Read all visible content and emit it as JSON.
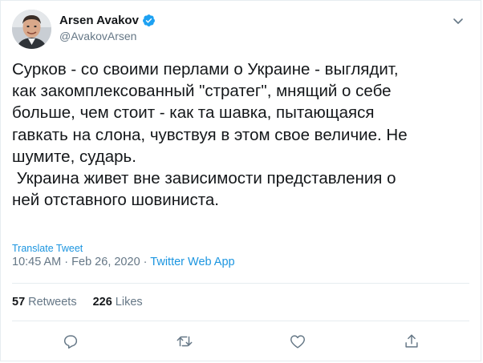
{
  "author": {
    "display_name": "Arsen Avakov",
    "handle": "@AvakovArsen",
    "verified": true
  },
  "tweet": {
    "text_lines": [
      "Сурков - со своими перлами о Украине - выглядит,",
      "как закомплексованный \"стратег\", мнящий о себе",
      "больше, чем стоит - как та шавка, пытающаяся",
      "гавкать на слона, чувствуя в этом свое величие. Не",
      "шумите, сударь.",
      " Украина живет вне зависимости представления о",
      "ней отставного шовиниста."
    ]
  },
  "translate_label": "Translate Tweet",
  "meta": {
    "time": "10:45 AM",
    "separator": "·",
    "date": "Feb 26, 2020",
    "source": "Twitter Web App"
  },
  "stats": {
    "retweets_count": "57",
    "retweets_label": "Retweets",
    "likes_count": "226",
    "likes_label": "Likes"
  },
  "icons": {
    "verified": "verified-badge-icon",
    "caret": "chevron-down-icon",
    "reply": "reply-icon",
    "retweet": "retweet-icon",
    "like": "heart-icon",
    "share": "share-icon"
  },
  "colors": {
    "link": "#1b95e0",
    "secondary_text": "#657786",
    "primary_text": "#14171a",
    "divider": "#e6ecf0",
    "verified": "#1da1f2"
  }
}
